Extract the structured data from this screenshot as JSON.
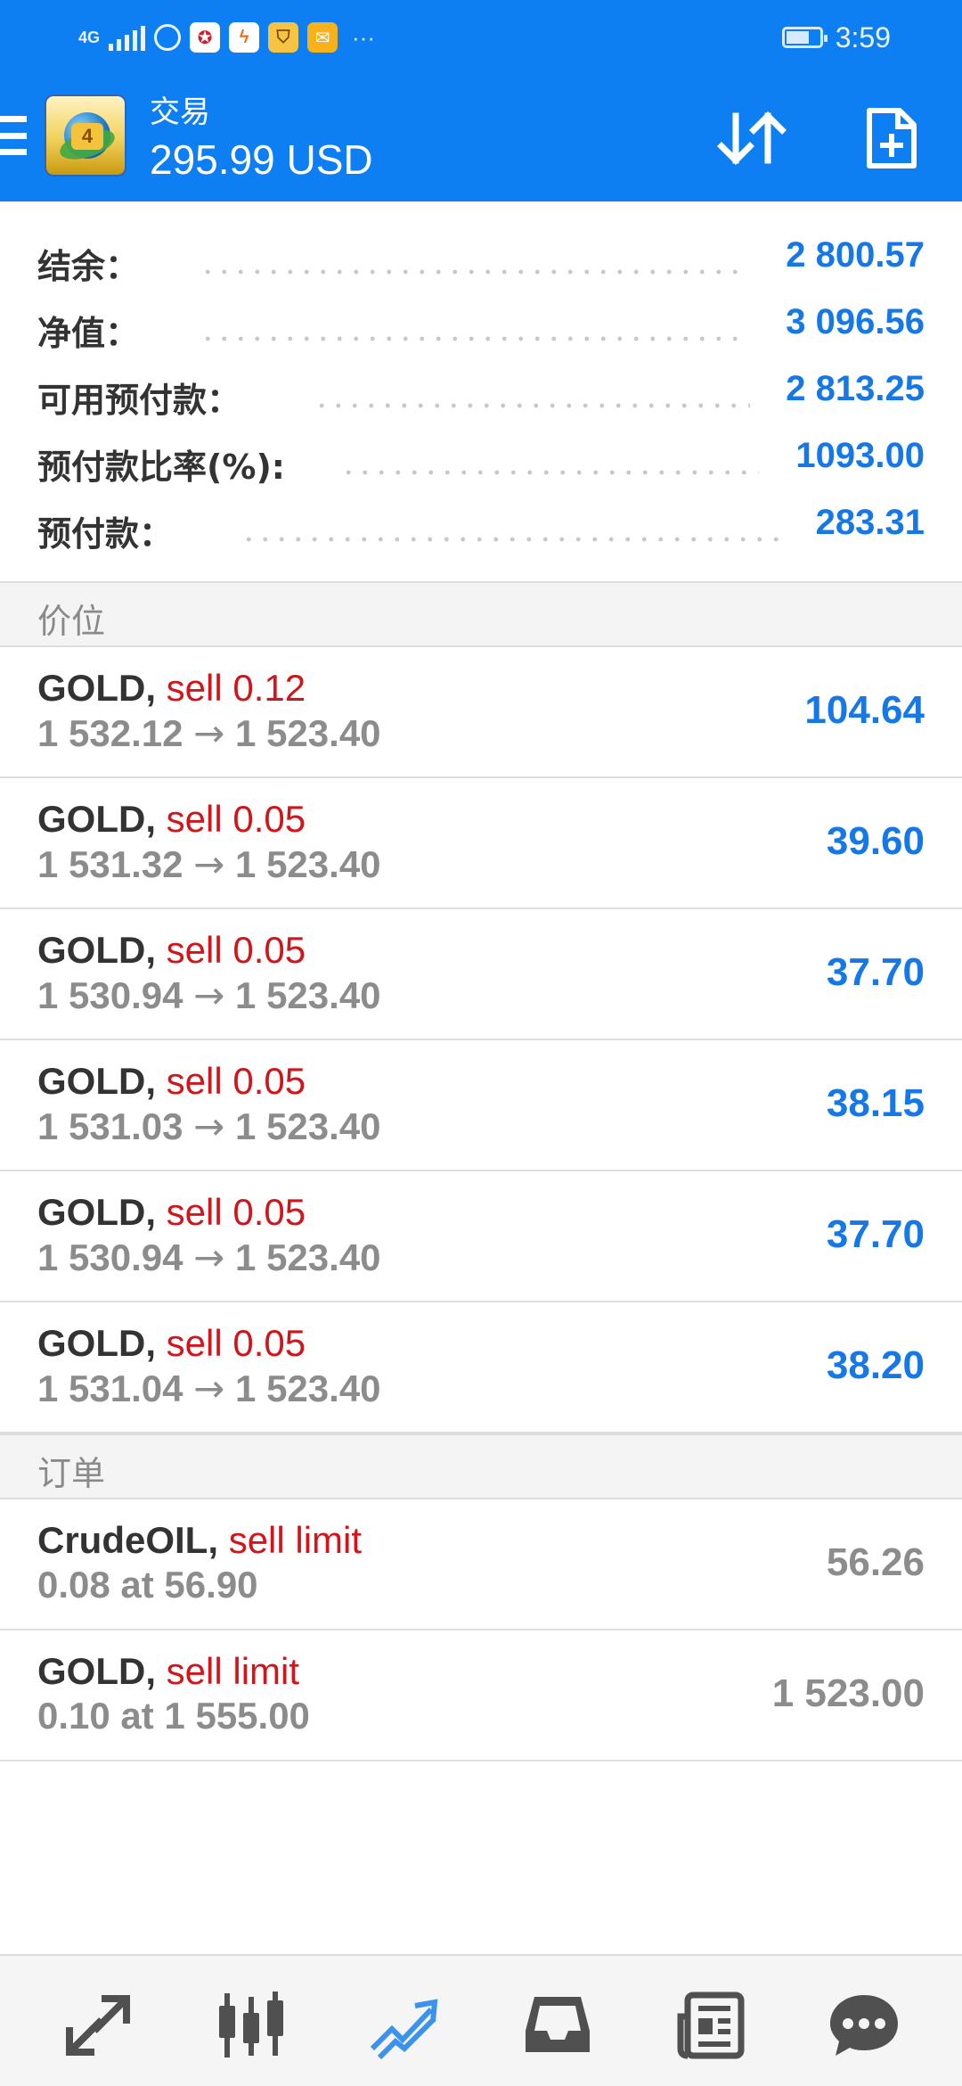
{
  "status_bar": {
    "network": "4G",
    "time": "3:59",
    "overflow": "···",
    "app_icons": [
      "globe-icon",
      "app-icon-1",
      "app-icon-2",
      "app-icon-3",
      "mail-icon"
    ]
  },
  "app_bar": {
    "title": "交易",
    "balance": "295.99 USD",
    "icons": [
      "menu-icon",
      "mt4-logo",
      "sort-icon",
      "new-order-icon"
    ]
  },
  "summary": [
    {
      "label": "结余：",
      "value": "2 800.57"
    },
    {
      "label": "净值：",
      "value": "3 096.56"
    },
    {
      "label": "可用预付款：",
      "value": "2 813.25"
    },
    {
      "label": "预付款比率(%):",
      "value": "1093.00"
    },
    {
      "label": "预付款：",
      "value": "283.31"
    }
  ],
  "positions_header": "价位",
  "positions": [
    {
      "symbol": "GOLD,",
      "action": "sell 0.12",
      "open": "1 532.12",
      "arrow": "→",
      "current": "1 523.40",
      "profit": "104.64"
    },
    {
      "symbol": "GOLD,",
      "action": "sell 0.05",
      "open": "1 531.32",
      "arrow": "→",
      "current": "1 523.40",
      "profit": "39.60"
    },
    {
      "symbol": "GOLD,",
      "action": "sell 0.05",
      "open": "1 530.94",
      "arrow": "→",
      "current": "1 523.40",
      "profit": "37.70"
    },
    {
      "symbol": "GOLD,",
      "action": "sell 0.05",
      "open": "1 531.03",
      "arrow": "→",
      "current": "1 523.40",
      "profit": "38.15"
    },
    {
      "symbol": "GOLD,",
      "action": "sell 0.05",
      "open": "1 530.94",
      "arrow": "→",
      "current": "1 523.40",
      "profit": "37.70"
    },
    {
      "symbol": "GOLD,",
      "action": "sell 0.05",
      "open": "1 531.04",
      "arrow": "→",
      "current": "1 523.40",
      "profit": "38.20"
    }
  ],
  "orders_header": "订单",
  "orders": [
    {
      "symbol": "CrudeOIL,",
      "action": "sell limit",
      "detail": "0.08 at 56.90",
      "price": "56.26"
    },
    {
      "symbol": "GOLD,",
      "action": "sell limit",
      "detail": "0.10 at 1 555.00",
      "price": "1 523.00"
    }
  ],
  "bottom_nav": [
    "quotes-icon",
    "chart-icon",
    "trade-icon",
    "history-icon",
    "news-icon",
    "chat-icon"
  ],
  "colors": {
    "header_blue": "#0e7ef3",
    "value_blue": "#1678e6",
    "sell_red": "#d0151b",
    "active_nav": "#3b93ec",
    "nav_inactive": "#505050"
  }
}
